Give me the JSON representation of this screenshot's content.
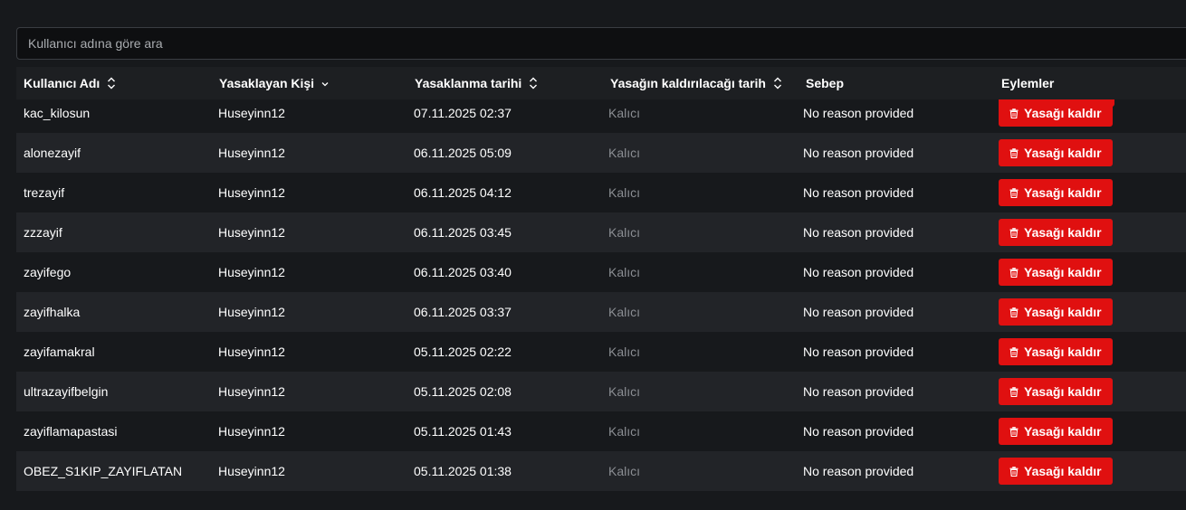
{
  "search": {
    "placeholder": "Kullanıcı adına göre ara"
  },
  "table": {
    "headers": [
      {
        "label": "Kullanıcı Adı",
        "indicator": "sort"
      },
      {
        "label": "Yasaklayan Kişi",
        "indicator": "chevron-down"
      },
      {
        "label": "Yasaklanma tarihi",
        "indicator": "sort"
      },
      {
        "label": "Yasağın kaldırılacağı tarih",
        "indicator": "sort"
      },
      {
        "label": "Sebep",
        "indicator": "none"
      },
      {
        "label": "Eylemler",
        "indicator": "none"
      }
    ],
    "unban_label": "Yasağı kaldır",
    "rows": [
      {
        "username": "kac_kilosun",
        "banned_by": "Huseyinn12",
        "ban_date": "07.11.2025 02:37",
        "unban_date": "Kalıcı",
        "reason": "No reason provided"
      },
      {
        "username": "alonezayif",
        "banned_by": "Huseyinn12",
        "ban_date": "06.11.2025 05:09",
        "unban_date": "Kalıcı",
        "reason": "No reason provided"
      },
      {
        "username": "trezayif",
        "banned_by": "Huseyinn12",
        "ban_date": "06.11.2025 04:12",
        "unban_date": "Kalıcı",
        "reason": "No reason provided"
      },
      {
        "username": "zzzayif",
        "banned_by": "Huseyinn12",
        "ban_date": "06.11.2025 03:45",
        "unban_date": "Kalıcı",
        "reason": "No reason provided"
      },
      {
        "username": "zayifego",
        "banned_by": "Huseyinn12",
        "ban_date": "06.11.2025 03:40",
        "unban_date": "Kalıcı",
        "reason": "No reason provided"
      },
      {
        "username": "zayifhalka",
        "banned_by": "Huseyinn12",
        "ban_date": "06.11.2025 03:37",
        "unban_date": "Kalıcı",
        "reason": "No reason provided"
      },
      {
        "username": "zayifamakral",
        "banned_by": "Huseyinn12",
        "ban_date": "05.11.2025 02:22",
        "unban_date": "Kalıcı",
        "reason": "No reason provided"
      },
      {
        "username": "ultrazayifbelgin",
        "banned_by": "Huseyinn12",
        "ban_date": "05.11.2025 02:08",
        "unban_date": "Kalıcı",
        "reason": "No reason provided"
      },
      {
        "username": "zayiflamapastasi",
        "banned_by": "Huseyinn12",
        "ban_date": "05.11.2025 01:43",
        "unban_date": "Kalıcı",
        "reason": "No reason provided"
      },
      {
        "username": "OBEZ_S1KIP_ZAYIFLATAN",
        "banned_by": "Huseyinn12",
        "ban_date": "05.11.2025 01:38",
        "unban_date": "Kalıcı",
        "reason": "No reason provided"
      }
    ]
  },
  "colors": {
    "background": "#17191c",
    "accent_red": "#e01010",
    "muted_text": "#8b8e93",
    "row_alt": "#222428"
  },
  "icons": {
    "sort": "sort-icon",
    "chevron": "chevron-down-icon",
    "trash": "trash-icon"
  }
}
